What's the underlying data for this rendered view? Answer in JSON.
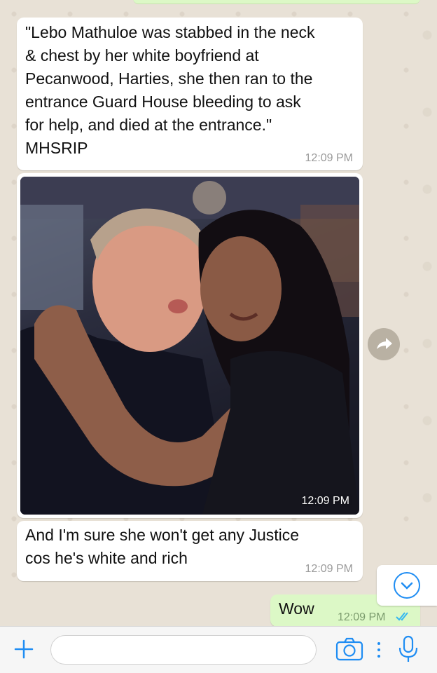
{
  "messages": [
    {
      "direction": "incoming",
      "text": "\"Lebo Mathuloe was stabbed in the neck\n& chest by her white boyfriend at\nPecanwood, Harties, she then ran to the\nentrance Guard House bleeding to ask\nfor help, and died at the entrance.\"\nMHSRIP",
      "time": "12:09 PM"
    },
    {
      "direction": "incoming",
      "type": "image",
      "image_description": "selfie of a man and a woman cheek to cheek in a dim bar",
      "time": "12:09 PM"
    },
    {
      "direction": "incoming",
      "text": "And I'm sure she won't get any Justice\ncos he's white and rich",
      "time": "12:09 PM"
    },
    {
      "direction": "outgoing",
      "text": "Wow",
      "time": "12:09 PM",
      "status": "read"
    }
  ],
  "composer": {
    "placeholder": ""
  },
  "icons": {
    "forward": "forward-icon",
    "scroll_down": "chevron-down-icon",
    "add": "plus-icon",
    "camera": "camera-icon",
    "more": "more-dots-icon",
    "mic": "microphone-icon",
    "read_ticks": "double-check-icon"
  },
  "colors": {
    "incoming_bubble": "#ffffff",
    "outgoing_bubble": "#dcf8c6",
    "accent_blue": "#1f8df3",
    "read_ticks": "#34b7f1",
    "chat_background": "#e8e1d6"
  }
}
